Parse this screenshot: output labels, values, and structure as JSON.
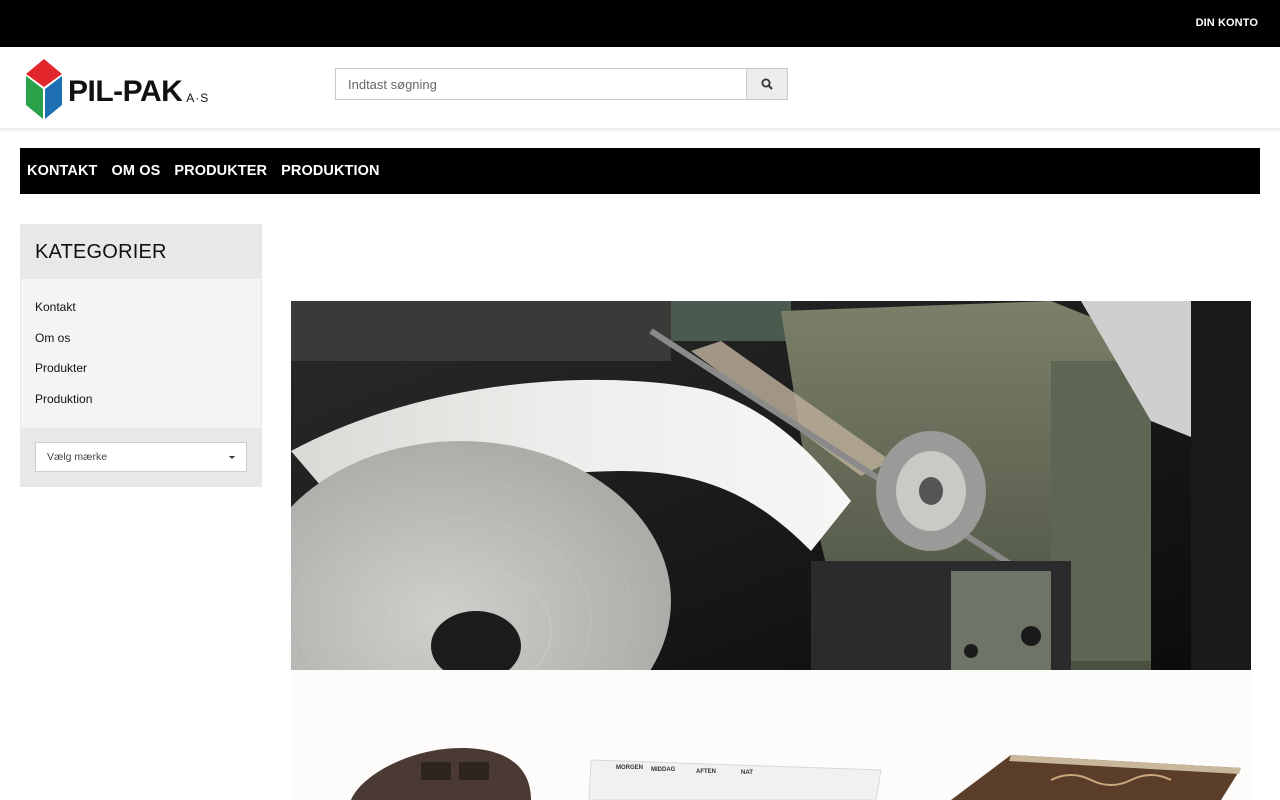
{
  "topbar": {
    "account_label": "DIN KONTO"
  },
  "header": {
    "logo": {
      "name": "PIL-PAK",
      "suffix": "A·S",
      "icon": "cube-logo-icon"
    },
    "search": {
      "placeholder": "Indtast søgning",
      "value": "",
      "button_icon": "search-icon"
    }
  },
  "nav": {
    "items": [
      {
        "label": "KONTAKT"
      },
      {
        "label": "OM OS"
      },
      {
        "label": "PRODUKTER"
      },
      {
        "label": "PRODUKTION"
      }
    ]
  },
  "sidebar": {
    "title": "KATEGORIER",
    "items": [
      {
        "label": "Kontakt"
      },
      {
        "label": "Om os"
      },
      {
        "label": "Produkter"
      },
      {
        "label": "Produktion"
      }
    ],
    "brand_select": {
      "selected": "Vælg mærke",
      "icon": "caret-down-icon"
    }
  },
  "main": {
    "hero": {
      "subject": "paper-roll-machine-image"
    },
    "products_banner": {
      "labels": [
        "MORGEN",
        "MIDDAG",
        "AFTEN",
        "NAT"
      ]
    }
  },
  "colors": {
    "topbar": "#000000",
    "nav": "#000000",
    "sidebar_head": "#e8e8e8",
    "sidebar_body": "#f4f4f4",
    "logo_red": "#e3262b",
    "logo_blue": "#1f6fb5",
    "logo_green": "#2aa24a"
  }
}
